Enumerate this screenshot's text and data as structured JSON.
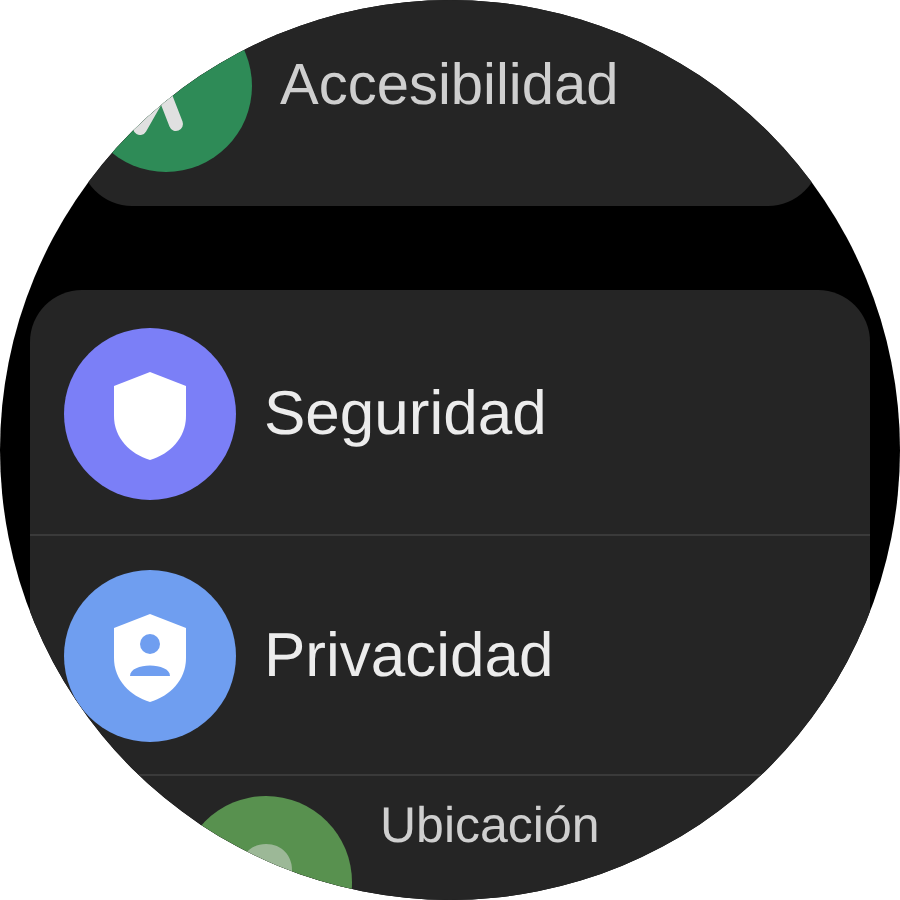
{
  "groups": [
    {
      "items": [
        {
          "label": "Accesibilidad",
          "kind": "accessibility",
          "color": "#2e8b57"
        }
      ]
    },
    {
      "items": [
        {
          "label": "Seguridad",
          "kind": "shield",
          "color": "#7b7ff7"
        },
        {
          "label": "Privacidad",
          "kind": "privacy",
          "color": "#6f9ef0"
        },
        {
          "label": "Ubicación",
          "kind": "location",
          "color": "#58914f"
        }
      ]
    }
  ]
}
